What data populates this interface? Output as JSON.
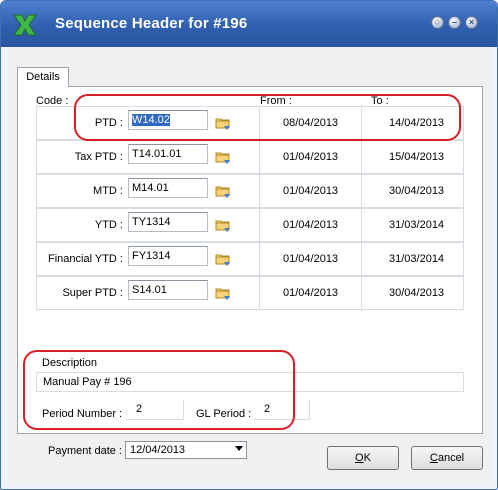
{
  "window": {
    "title": "Sequence Header for #196",
    "controls": [
      "restore-icon",
      "minimize-icon",
      "close-icon"
    ]
  },
  "tabs": [
    {
      "label": "Details",
      "selected": true
    }
  ],
  "headers": {
    "code": "Code :",
    "from": "From :",
    "to": "To :"
  },
  "rows": [
    {
      "label": "PTD :",
      "code": "W14.02",
      "from": "08/04/2013",
      "to": "14/04/2013",
      "selected": true
    },
    {
      "label": "Tax PTD :",
      "code": "T14.01.01",
      "from": "01/04/2013",
      "to": "15/04/2013"
    },
    {
      "label": "MTD :",
      "code": "M14.01",
      "from": "01/04/2013",
      "to": "30/04/2013"
    },
    {
      "label": "YTD :",
      "code": "TY1314",
      "from": "01/04/2013",
      "to": "31/03/2014"
    },
    {
      "label": "Financial YTD :",
      "code": "FY1314",
      "from": "01/04/2013",
      "to": "31/03/2014"
    },
    {
      "label": "Super PTD :",
      "code": "S14.01",
      "from": "01/04/2013",
      "to": "30/04/2013"
    }
  ],
  "description": {
    "label": "Description",
    "value": "Manual Pay # 196"
  },
  "period": {
    "label": "Period Number :",
    "value": "2"
  },
  "gl_period": {
    "label": "GL Period :",
    "value": "2"
  },
  "payment_date": {
    "label": "Payment date :",
    "value": "12/04/2013"
  },
  "buttons": {
    "ok": "OK",
    "cancel": "Cancel"
  },
  "colors": {
    "titlebar": "#2f5fae",
    "annotation": "#d91f26",
    "selection": "#3069c4"
  }
}
